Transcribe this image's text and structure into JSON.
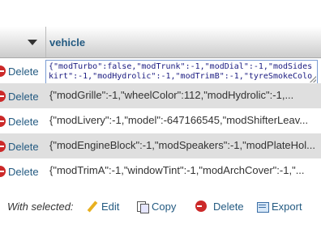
{
  "table": {
    "column_header": "vehicle",
    "rows": [
      {
        "action_label": "Delete",
        "editing": true,
        "editor_lines": [
          "{\"modTurbo\":false,\"modTrunk\":-1,\"modDial\":-1,\"modSides",
          "kirt\":-1,\"modHydrolic\":-1,\"modTrimB\":-1,\"tyreSmokeColo"
        ]
      },
      {
        "action_label": "Delete",
        "text": "{\"modGrille\":-1,\"wheelColor\":112,\"modHydrolic\":-1,..."
      },
      {
        "action_label": "Delete",
        "text": "{\"modLivery\":-1,\"model\":-647166545,\"modShifterLeav..."
      },
      {
        "action_label": "Delete",
        "text": "{\"modEngineBlock\":-1,\"modSpeakers\":-1,\"modPlateHol..."
      },
      {
        "action_label": "Delete",
        "text": "{\"modTrimA\":-1,\"windowTint\":-1,\"modArchCover\":-1,\"..."
      }
    ]
  },
  "footer": {
    "with_selected": "With selected:",
    "edit": "Edit",
    "copy": "Copy",
    "delete": "Delete",
    "export": "Export"
  }
}
